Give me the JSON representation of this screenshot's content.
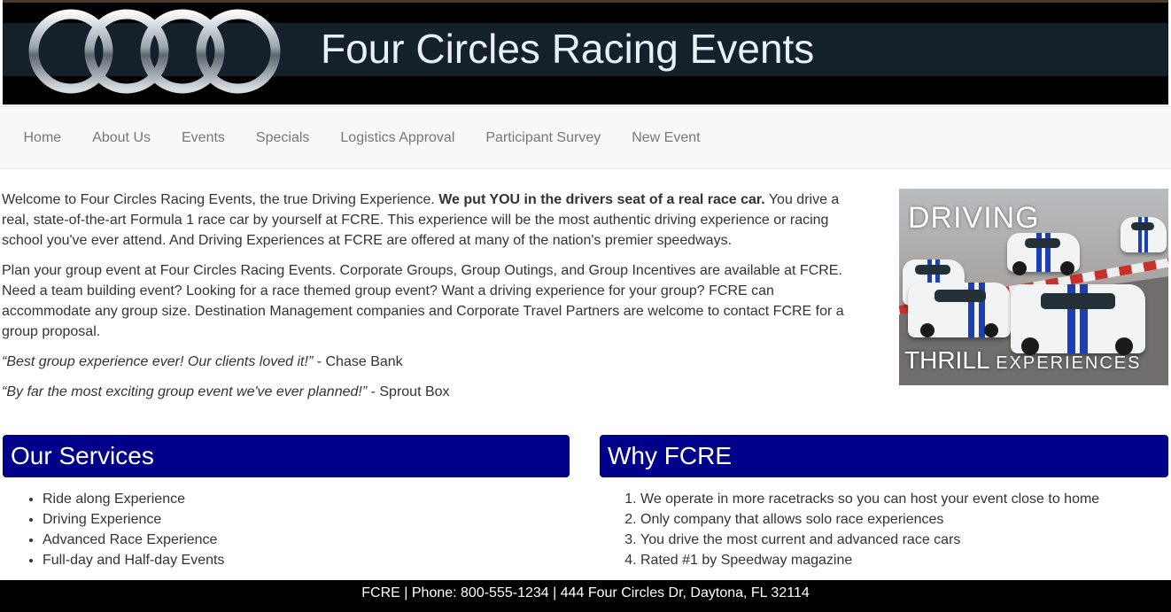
{
  "header": {
    "title": "Four Circles Racing Events",
    "logo_icon": "four-rings-logo-icon"
  },
  "nav": {
    "items": [
      "Home",
      "About Us",
      "Events",
      "Specials",
      "Logistics Approval",
      "Participant Survey",
      "New Event"
    ]
  },
  "intro": {
    "p1_start": "Welcome to Four Circles Racing Events, the true Driving Experience. ",
    "p1_bold": "We put YOU in the drivers seat of a real race car.",
    "p1_end": " You drive a real, state-of-the-art Formula 1 race car by yourself at FCRE. This experience will be the most authentic driving experience or racing school you've ever attend. And Driving Experiences at FCRE are offered at many of the nation's premier speedways.",
    "p2": "Plan your group event at Four Circles Racing Events. Corporate Groups, Group Outings, and Group Incentives are available at FCRE. Need a team building event? Looking for a race themed group event? Want a driving experience for your group? FCRE can accommodate any group size. Destination Management companies and Corporate Travel Partners are welcome to contact FCRE for a group proposal.",
    "quote1": "“Best group experience ever! Our clients loved it!”",
    "quote1_source": " - Chase Bank",
    "quote2": "“By far the most exciting group event we've ever planned!”",
    "quote2_source": " - Sprout Box"
  },
  "promo": {
    "top_word": "DRIVING",
    "bottom_word_big": "THRILL",
    "bottom_word_small": "EXPERIENCES"
  },
  "services": {
    "title": "Our Services",
    "items": [
      "Ride along Experience",
      "Driving Experience",
      "Advanced Race Experience",
      "Full-day and Half-day Events"
    ]
  },
  "why": {
    "title": "Why FCRE",
    "items": [
      "We operate in more racetracks so you can host your event close to home",
      "Only company that allows solo race experiences",
      "You drive the most current and advanced race cars",
      "Rated #1 by Speedway magazine"
    ]
  },
  "footer": {
    "text": "FCRE | Phone: 800-555-1234 | 444 Four Circles Dr, Daytona, FL 32114"
  },
  "colors": {
    "panel_heading": "#00008b",
    "nav_text": "#777777",
    "footer_bg": "#000000"
  }
}
